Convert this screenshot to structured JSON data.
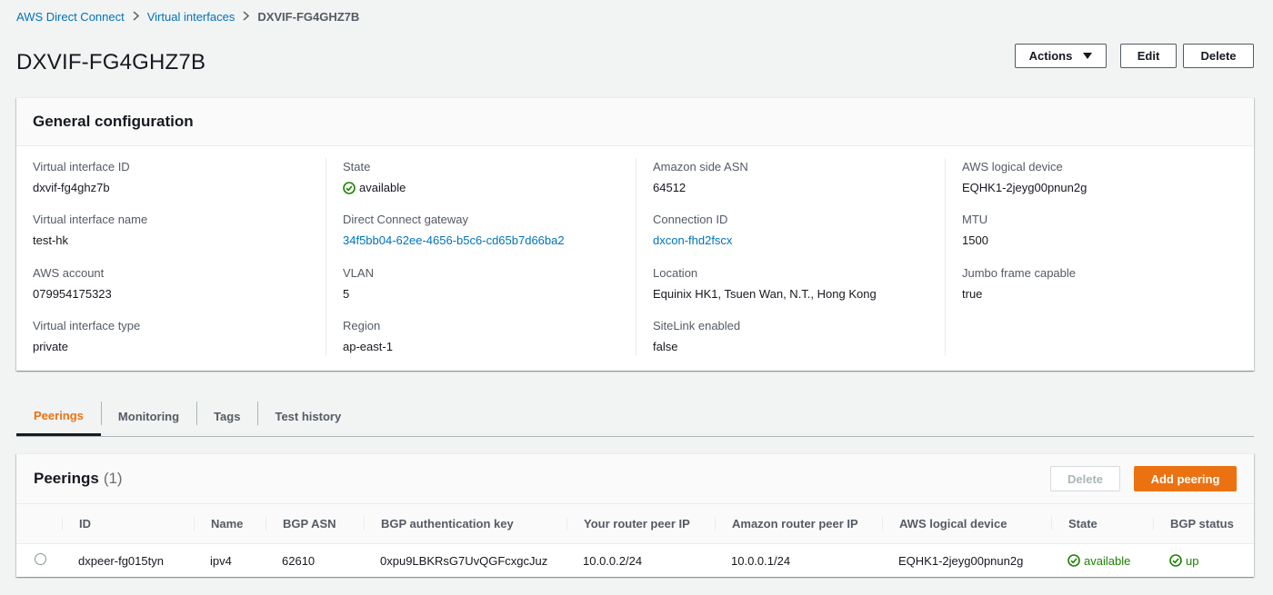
{
  "breadcrumb": {
    "items": [
      "AWS Direct Connect",
      "Virtual interfaces"
    ],
    "current": "DXVIF-FG4GHZ7B"
  },
  "page_title": "DXVIF-FG4GHZ7B",
  "header_actions": {
    "actions_label": "Actions",
    "edit_label": "Edit",
    "delete_label": "Delete"
  },
  "general_config": {
    "title": "General configuration",
    "virtual_interface_id": {
      "label": "Virtual interface ID",
      "value": "dxvif-fg4ghz7b"
    },
    "virtual_interface_name": {
      "label": "Virtual interface name",
      "value": "test-hk"
    },
    "aws_account": {
      "label": "AWS account",
      "value": "079954175323"
    },
    "virtual_interface_type": {
      "label": "Virtual interface type",
      "value": "private"
    },
    "state": {
      "label": "State",
      "value": "available"
    },
    "dx_gateway": {
      "label": "Direct Connect gateway",
      "value": "34f5bb04-62ee-4656-b5c6-cd65b7d66ba2"
    },
    "vlan": {
      "label": "VLAN",
      "value": "5"
    },
    "region": {
      "label": "Region",
      "value": "ap-east-1"
    },
    "amazon_side_asn": {
      "label": "Amazon side ASN",
      "value": "64512"
    },
    "connection_id": {
      "label": "Connection ID",
      "value": "dxcon-fhd2fscx"
    },
    "location": {
      "label": "Location",
      "value": "Equinix HK1, Tsuen Wan, N.T., Hong Kong"
    },
    "sitelink_enabled": {
      "label": "SiteLink enabled",
      "value": "false"
    },
    "aws_logical_device": {
      "label": "AWS logical device",
      "value": "EQHK1-2jeyg00pnun2g"
    },
    "mtu": {
      "label": "MTU",
      "value": "1500"
    },
    "jumbo_frame_capable": {
      "label": "Jumbo frame capable",
      "value": "true"
    }
  },
  "tabs": [
    "Peerings",
    "Monitoring",
    "Tags",
    "Test history"
  ],
  "peerings": {
    "title": "Peerings",
    "count": "(1)",
    "delete_label": "Delete",
    "add_label": "Add peering",
    "columns": [
      "ID",
      "Name",
      "BGP ASN",
      "BGP authentication key",
      "Your router peer IP",
      "Amazon router peer IP",
      "AWS logical device",
      "State",
      "BGP status"
    ],
    "rows": [
      {
        "id": "dxpeer-fg015tyn",
        "name": "ipv4",
        "bgp_asn": "62610",
        "auth_key": "0xpu9LBKRsG7UvQGFcxgcJuz",
        "your_ip": "10.0.0.2/24",
        "amazon_ip": "10.0.0.1/24",
        "logical_device": "EQHK1-2jeyg00pnun2g",
        "state": "available",
        "bgp_status": "up"
      }
    ]
  },
  "colors": {
    "link": "#0073bb",
    "success": "#1d8102",
    "primary": "#ec7211",
    "background": "#f2f3f3"
  },
  "icons": {
    "breadcrumb_separator": "chevron-right-icon",
    "actions_caret": "caret-down-icon",
    "status": "status-success-icon"
  }
}
